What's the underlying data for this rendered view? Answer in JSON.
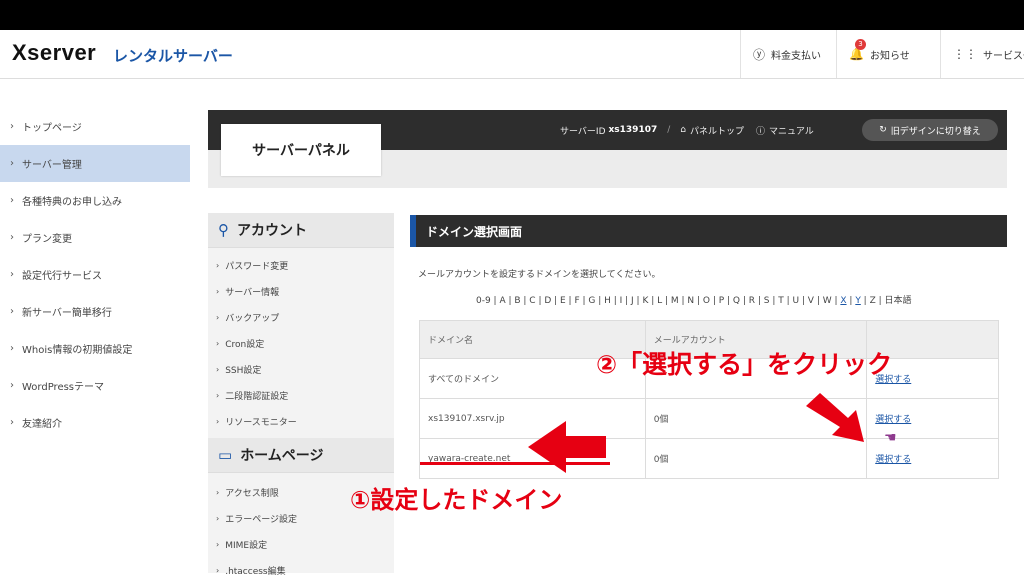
{
  "header": {
    "logo": "Xserver",
    "logo_sub": "レンタルサーバー",
    "items": [
      {
        "label": "料金支払い",
        "icon": "yen-icon"
      },
      {
        "label": "お知らせ",
        "icon": "bell-icon",
        "badge": "3"
      },
      {
        "label": "サービス一",
        "icon": "grid-icon"
      }
    ]
  },
  "sidebar": {
    "items": [
      {
        "label": "トップページ",
        "active": false
      },
      {
        "label": "サーバー管理",
        "active": true
      },
      {
        "label": "各種特典のお申し込み",
        "active": false
      },
      {
        "label": "プラン変更",
        "active": false
      },
      {
        "label": "設定代行サービス",
        "active": false
      },
      {
        "label": "新サーバー簡単移行",
        "active": false
      },
      {
        "label": "Whois情報の初期値設定",
        "active": false
      },
      {
        "label": "WordPressテーマ",
        "active": false
      },
      {
        "label": "友達紹介",
        "active": false
      }
    ]
  },
  "panel": {
    "title": "サーバーパネル",
    "server_id_label": "サーバーID",
    "server_id": "xs139107",
    "panel_top": "パネルトップ",
    "manual": "マニュアル",
    "old_design": "旧デザインに切り替え"
  },
  "leftnav": {
    "account_heading": "アカウント",
    "account_items": [
      "パスワード変更",
      "サーバー情報",
      "バックアップ",
      "Cron設定",
      "SSH設定",
      "二段階認証設定",
      "リソースモニター"
    ],
    "homepage_heading": "ホームページ",
    "homepage_items": [
      "アクセス制限",
      "エラーページ設定",
      "MIME設定",
      ".htaccess編集"
    ]
  },
  "main": {
    "heading": "ドメイン選択画面",
    "description": "メールアカウントを設定するドメインを選択してください。",
    "alpha_plain": "0-9 | A | B | C | D | E | F | G | H | I | J | K | L | M | N | O | P | Q | R | S | T | U | V | W | ",
    "alpha_links": [
      "X",
      "Y"
    ],
    "alpha_tail": " | Z | 日本語",
    "table": {
      "headers": [
        "ドメイン名",
        "メールアカウント",
        ""
      ],
      "rows": [
        {
          "domain": "すべてのドメイン",
          "count": "",
          "action": "選択する"
        },
        {
          "domain": "xs139107.xsrv.jp",
          "count": "0個",
          "action": "選択する"
        },
        {
          "domain": "yawara-create.net",
          "count": "0個",
          "action": "選択する"
        }
      ]
    }
  },
  "annotations": {
    "step1": "①設定したドメイン",
    "step2": "②「選択する」をクリック",
    "color": "#e60012"
  }
}
